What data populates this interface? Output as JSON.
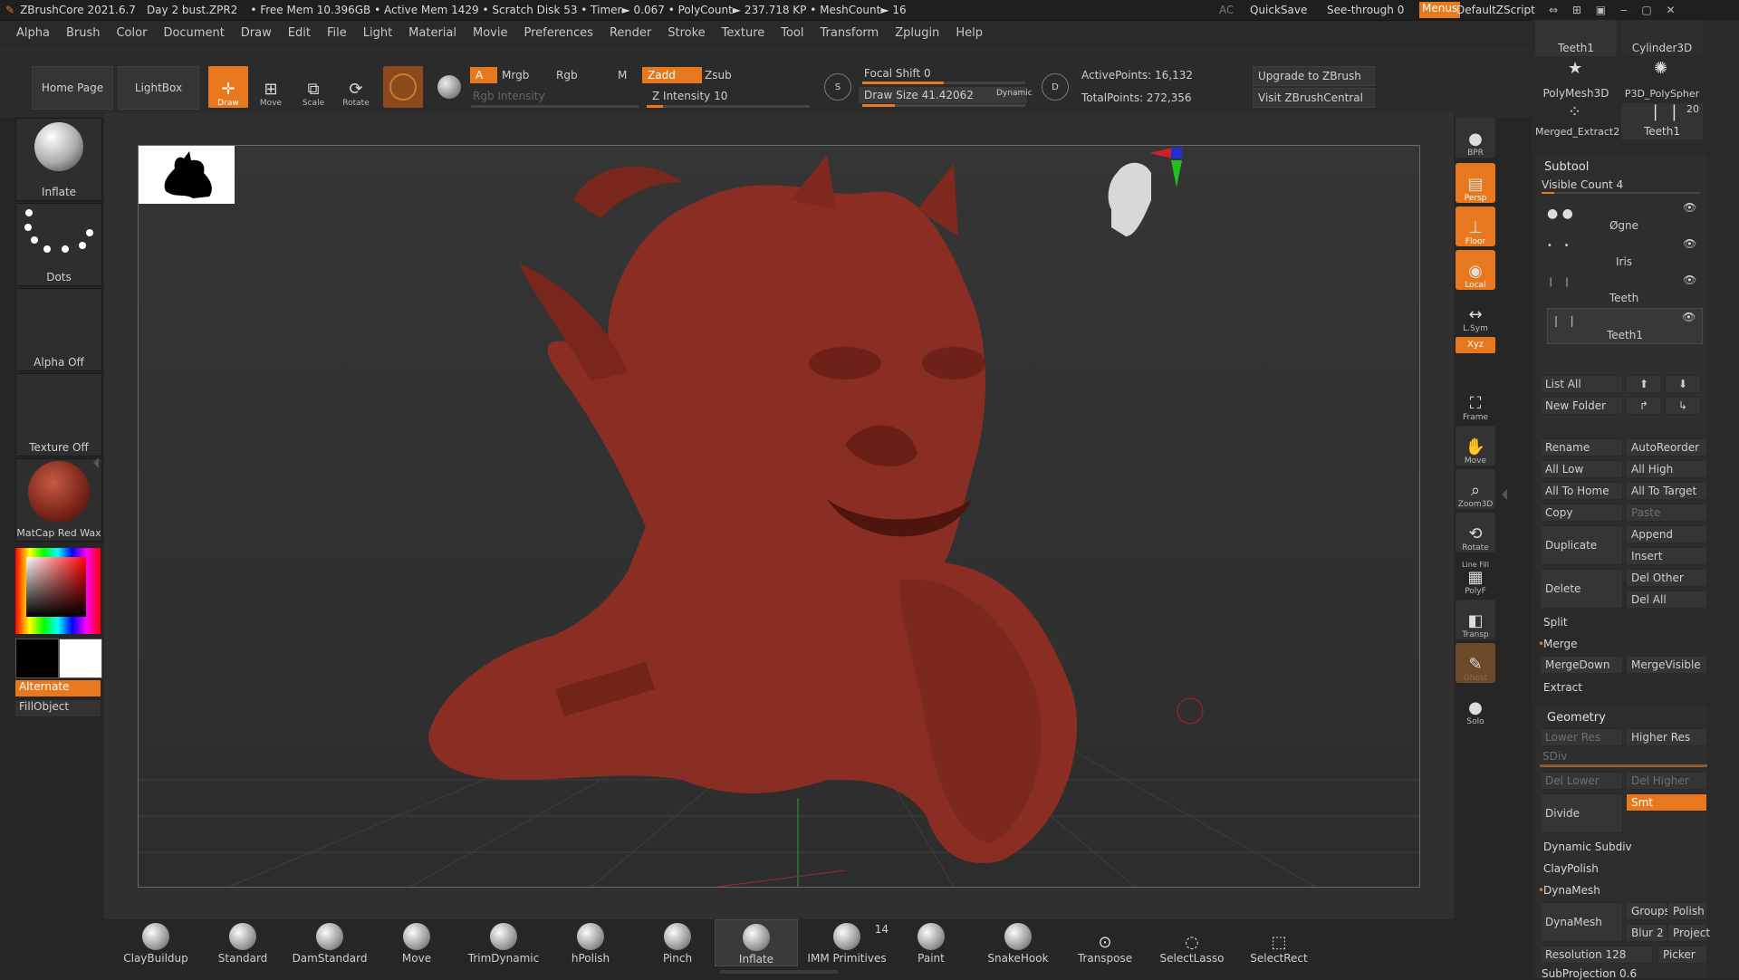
{
  "titlebar": {
    "app": "ZBrushCore 2021.6.7",
    "file": "Day 2 bust.ZPR2",
    "stats": "• Free Mem 10.396GB • Active Mem 1429 • Scratch Disk 53 • Timer► 0.067 • PolyCount► 237.718 KP • MeshCount► 16",
    "ac": "AC",
    "quicksave": "QuickSave",
    "seethrough": "See-through",
    "seethrough_value": "0",
    "menus": "Menus",
    "script": "DefaultZScript"
  },
  "menubar": [
    "Alpha",
    "Brush",
    "Color",
    "Document",
    "Draw",
    "Edit",
    "File",
    "Light",
    "Material",
    "Movie",
    "Preferences",
    "Render",
    "Stroke",
    "Texture",
    "Tool",
    "Transform",
    "Zplugin",
    "Help"
  ],
  "toolbar": {
    "home": "Home Page",
    "lightbox": "LightBox",
    "draw": "Draw",
    "move": "Move",
    "scale": "Scale",
    "rotate": "Rotate",
    "a": "A",
    "mrgb": "Mrgb",
    "rgb": "Rgb",
    "m": "M",
    "zadd": "Zadd",
    "zsub": "Zsub",
    "rgb_intensity": "Rgb Intensity",
    "z_intensity_label": "Z Intensity",
    "z_intensity": "10",
    "focal_shift_label": "Focal Shift",
    "focal_shift": "0",
    "draw_size_label": "Draw Size",
    "draw_size": "41.42062",
    "dynamic": "Dynamic",
    "active_points": "ActivePoints: 16,132",
    "total_points": "TotalPoints: 272,356",
    "upgrade": "Upgrade to ZBrush",
    "visit": "Visit ZBrushCentral",
    "s": "S",
    "d": "D",
    "z_intensity_level": 0.1,
    "focal_shift_level": 0.5,
    "draw_size_level": 0.2
  },
  "left": {
    "inflate": "Inflate",
    "dots": "Dots",
    "alpha": "Alpha Off",
    "texture": "Texture Off",
    "matcap": "MatCap Red Wax",
    "alternate": "Alternate",
    "fillobject": "FillObject"
  },
  "shelf": [
    "BPR",
    "Persp",
    "Floor",
    "Local",
    "L.Sym",
    "Xyz",
    "Frame",
    "Move",
    "Zoom3D",
    "Rotate",
    "Line Fill",
    "PolyF",
    "Transp",
    "Ghost",
    "Solo"
  ],
  "tools": {
    "teeth1_a": "Teeth1",
    "cylinder": "Cylinder3D",
    "polymesh": "PolyMesh3D",
    "p3d": "P3D_PolySpher",
    "merged": "Merged_Extract2",
    "teeth1_b": "Teeth1",
    "count": "20"
  },
  "subtool": {
    "title": "Subtool",
    "visible_count": "Visible Count 4",
    "items": [
      "Øgne",
      "Iris",
      "Teeth",
      "Teeth1"
    ],
    "list_all": "List All",
    "new_folder": "New Folder",
    "rename": "Rename",
    "autoreorder": "AutoReorder",
    "all_low": "All Low",
    "all_high": "All High",
    "all_to_home": "All To Home",
    "all_to_target": "All To Target",
    "copy": "Copy",
    "paste": "Paste",
    "duplicate": "Duplicate",
    "append": "Append",
    "insert": "Insert",
    "delete": "Delete",
    "del_other": "Del Other",
    "del_all": "Del All",
    "split": "Split",
    "merge": "Merge",
    "mergedown": "MergeDown",
    "mergevisible": "MergeVisible",
    "extract": "Extract"
  },
  "geometry": {
    "title": "Geometry",
    "lower_res": "Lower Res",
    "higher_res": "Higher Res",
    "sdiv": "SDiv",
    "del_lower": "Del Lower",
    "del_higher": "Del Higher",
    "divide": "Divide",
    "smt": "Smt",
    "dynamic_subdiv": "Dynamic Subdiv",
    "claypolish": "ClayPolish",
    "dynamesh_head": "DynaMesh",
    "dynamesh": "DynaMesh",
    "groups": "Groups",
    "polish": "Polish",
    "blur": "Blur",
    "blur_value": "2",
    "project": "Project",
    "resolution": "Resolution 128",
    "picker": "Picker",
    "subprojection": "SubProjection 0.6"
  },
  "brushes": [
    "ClayBuildup",
    "Standard",
    "DamStandard",
    "Move",
    "TrimDynamic",
    "hPolish",
    "Pinch",
    "Inflate",
    "IMM Primitives",
    "Paint",
    "SnakeHook",
    "Transpose",
    "SelectLasso",
    "SelectRect"
  ],
  "imm_count": "14",
  "colors": {
    "accent": "#e8781e",
    "model": "#8a2d22"
  }
}
